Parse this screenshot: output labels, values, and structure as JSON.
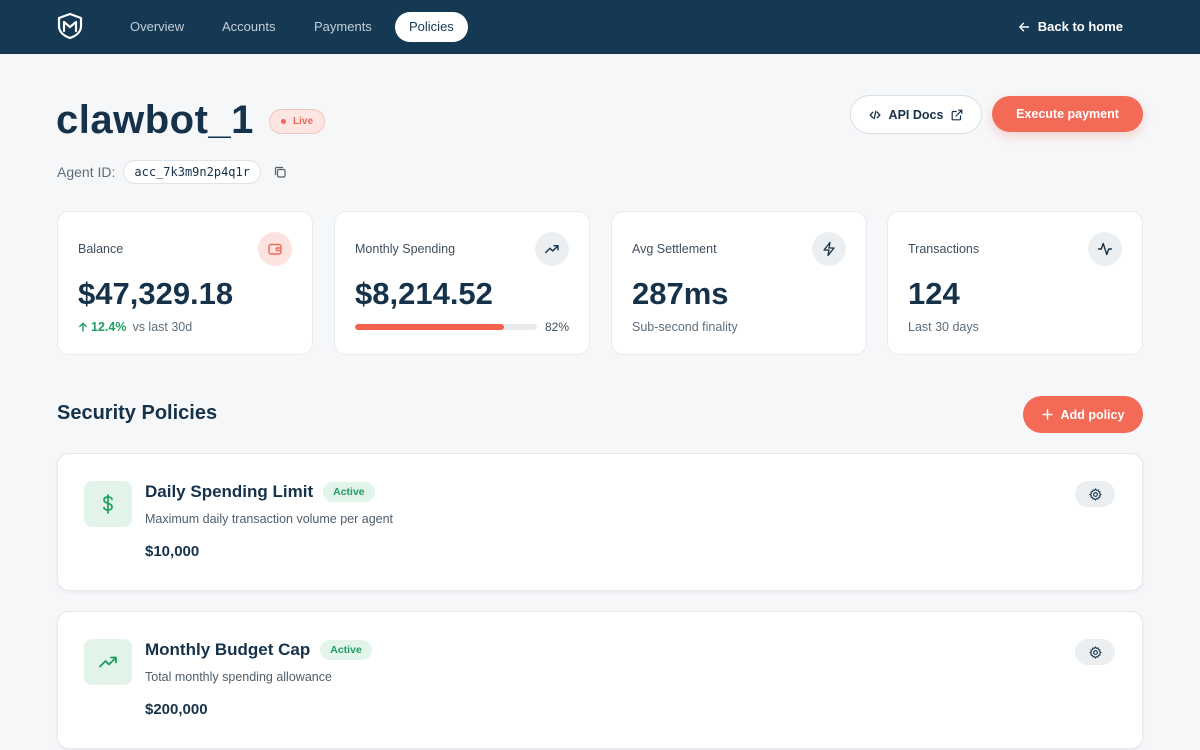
{
  "nav": {
    "logo_icon": "shield-m-logo",
    "items": [
      {
        "label": "Overview",
        "active": false
      },
      {
        "label": "Accounts",
        "active": false
      },
      {
        "label": "Payments",
        "active": false
      },
      {
        "label": "Policies",
        "active": true
      }
    ],
    "back_label": "Back to home"
  },
  "agent": {
    "name": "clawbot_1",
    "status": "Live",
    "id_label": "Agent ID:",
    "id_value": "acc_7k3m9n2p4q1r"
  },
  "actions": {
    "api_docs_label": "API Docs",
    "execute_label": "Execute payment"
  },
  "stats": {
    "balance": {
      "label": "Balance",
      "value": "$47,329.18",
      "trend": "12.4%",
      "trend_note": "vs last 30d",
      "icon": "wallet-icon"
    },
    "monthly_spending": {
      "label": "Monthly Spending",
      "value": "$8,214.52",
      "percent_label": "82%",
      "percent": 0.82,
      "icon": "trending-up-icon"
    },
    "avg_settlement": {
      "label": "Avg Settlement",
      "value": "287ms",
      "sub": "Sub-second finality",
      "icon": "lightning-icon"
    },
    "transactions": {
      "label": "Transactions",
      "value": "124",
      "sub": "Last 30 days",
      "icon": "activity-icon"
    }
  },
  "policies": {
    "section_title": "Security Policies",
    "add_label": "Add policy",
    "items": [
      {
        "title": "Daily Spending Limit",
        "status": "Active",
        "description": "Maximum daily transaction volume per agent",
        "value": "$10,000",
        "icon": "dollar-icon"
      },
      {
        "title": "Monthly Budget Cap",
        "status": "Active",
        "description": "Total monthly spending allowance",
        "value": "$200,000",
        "icon": "trending-up-icon"
      }
    ]
  },
  "colors": {
    "nav_bg": "#153853",
    "accent": "#f36a57",
    "success": "#1f9d63",
    "page_bg": "#f6f7f9"
  }
}
